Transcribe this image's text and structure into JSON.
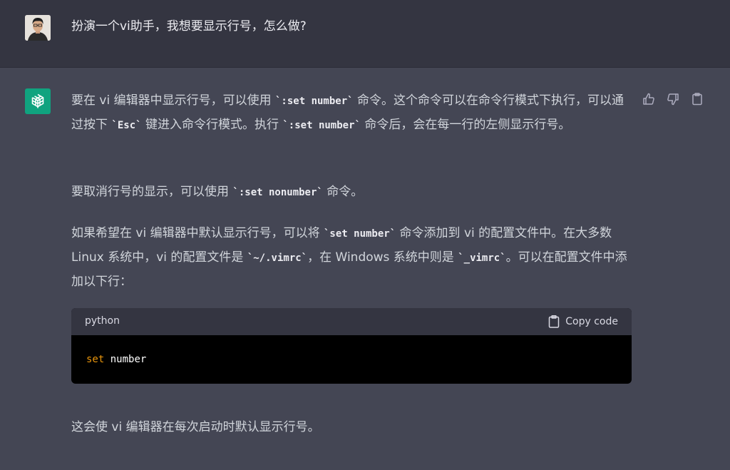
{
  "user_message": {
    "text": "扮演一个vi助手，我想要显示行号，怎么做?"
  },
  "assistant_message": {
    "p1": {
      "a": "要在 vi 编辑器中显示行号，可以使用 ",
      "code1": "`:set number`",
      "b": " 命令。这个命令可以在命令行模式下执行，可以通过按下 ",
      "code2": "`Esc`",
      "c": " 键进入命令行模式。执行 ",
      "code3": "`:set number`",
      "d": " 命令后，会在每一行的左侧显示行号。"
    },
    "p2": {
      "a": "要取消行号的显示，可以使用 ",
      "code1": "`:set nonumber`",
      "b": " 命令。"
    },
    "p3": {
      "a": "如果希望在 vi 编辑器中默认显示行号，可以将 ",
      "code1": "`set number`",
      "b": " 命令添加到 vi 的配置文件中。在大多数 Linux 系统中，vi 的配置文件是 ",
      "code2": "`~/.vimrc`",
      "c": "，在 Windows 系统中则是 ",
      "code3": "`_vimrc`",
      "d": "。可以在配置文件中添加以下行："
    },
    "code_block": {
      "language": "python",
      "copy_label": "Copy code",
      "keyword": "set",
      "rest": " number"
    },
    "p4": {
      "text": "这会使 vi 编辑器在每次启动时默认显示行号。"
    }
  },
  "actions": {
    "icons": [
      "thumbs-up-icon",
      "thumbs-down-icon",
      "clipboard-icon"
    ]
  },
  "colors": {
    "user_bg": "#343541",
    "assistant_bg": "#444654",
    "brand": "#10a37f",
    "keyword": "#e9950c"
  }
}
